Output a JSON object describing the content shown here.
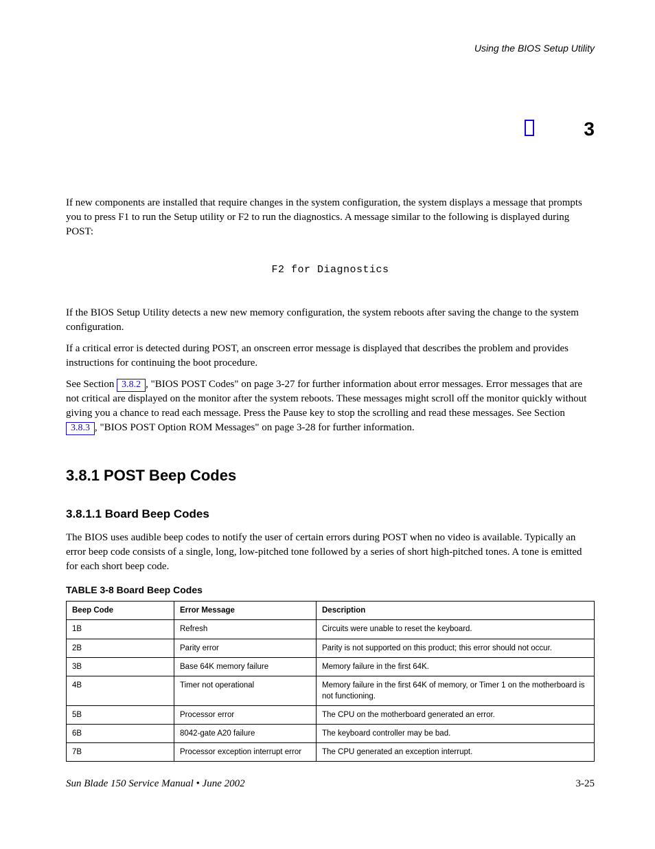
{
  "header": "Using the BIOS Setup Utility",
  "chapter_number": "3",
  "para1": "If new components are installed that require changes in the system configuration, the system displays a message that prompts you to press F1 to run the Setup utility or F2 to run the diagnostics. A message similar to the following is displayed during POST:",
  "mono_hint": "F2 for Diagnostics",
  "para2": "If the BIOS Setup Utility detects a new new memory configuration, the system reboots after saving the change to the system configuration.",
  "para3": "If a critical error is detected during POST, an onscreen error message is displayed that describes the problem and provides instructions for continuing the boot procedure.",
  "para4_a": "See Section ",
  "para4_link1": "3.8.2",
  "para4_b": ", \"BIOS POST Codes\" on page 3-27 for further information about error messages. Error messages that are not critical are displayed on the monitor after the system reboots. These messages might scroll off the monitor quickly without giving you a chance to read each message. Press the Pause key to stop the scrolling and read these messages. See Section ",
  "para4_link2": "3.8.3",
  "para4_c": ", \"BIOS POST Option ROM Messages\" on page 3-28 for further information.",
  "sec_beep": {
    "title": "3.8.1    POST Beep Codes",
    "h3": "3.8.1.1    Board Beep Codes",
    "p": "The BIOS uses audible beep codes to notify the user of certain errors during POST when no video is available. Typically an error beep code consists of a single, long, low-pitched tone followed by a series of short high-pitched tones. A tone is emitted for each short beep code.",
    "caption": "TABLE 3-8    Board Beep Codes",
    "headers": [
      "Beep Code",
      "Error Message",
      "Description"
    ],
    "rows": [
      [
        "1B",
        "Refresh",
        "Circuits were unable to reset the keyboard."
      ],
      [
        "2B",
        "Parity error",
        "Parity is not supported on this product; this error should not occur."
      ],
      [
        "3B",
        "Base 64K memory failure",
        "Memory failure in the first 64K."
      ],
      [
        "4B",
        "Timer not operational",
        "Memory failure in the first 64K of memory, or Timer 1 on the motherboard is not functioning."
      ],
      [
        "5B",
        "Processor error",
        "The CPU on the motherboard generated an error."
      ],
      [
        "6B",
        "8042-gate A20 failure",
        "The keyboard controller may be bad."
      ],
      [
        "7B",
        "Processor exception interrupt error",
        "The CPU generated an exception interrupt."
      ]
    ]
  },
  "footer_left": "Sun Blade 150 Service Manual • June 2002",
  "footer_right": "3-25"
}
